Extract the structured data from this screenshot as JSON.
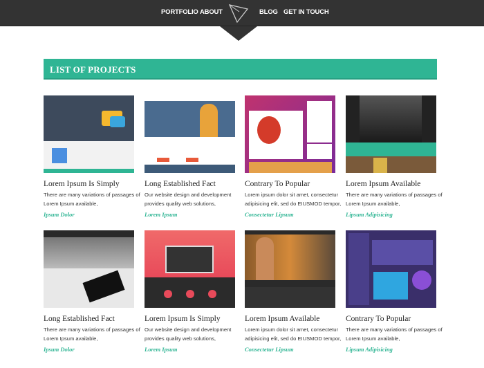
{
  "nav": {
    "items": [
      {
        "label": "PORTFOLIO"
      },
      {
        "label": "ABOUT"
      },
      {
        "label": "BLOG"
      },
      {
        "label": "GET IN TOUCH"
      }
    ]
  },
  "banner": {
    "title": "LIST OF PROJECTS"
  },
  "colors": {
    "accent": "#2fb594",
    "nav_bg": "#333333"
  },
  "projects": [
    {
      "title": "Lorem Ipsum Is Simply",
      "desc1": "There are many variations of passages of",
      "desc2": "Lorem Ipsum available,",
      "link": "Ipsum Dolor"
    },
    {
      "title": "Long Established Fact",
      "desc1": "Our website design and development",
      "desc2": "provides quality web solutions,",
      "link": "Lorem Ipsum"
    },
    {
      "title": "Contrary To Popular",
      "desc1": "Lorem ipsum dolor sit amet, consectetur",
      "desc2": "adipisicing elit, sed do EIUSMOD tempor,",
      "link": "Consectetur Lipsum"
    },
    {
      "title": "Lorem Ipsum Available",
      "desc1": "There are many variations of passages of",
      "desc2": "Lorem Ipsum available,",
      "link": "Lipsum Adipisicing"
    },
    {
      "title": "Long Established Fact",
      "desc1": "There are many variations of passages of",
      "desc2": "Lorem Ipsum available,",
      "link": "Ipsum Dolor"
    },
    {
      "title": "Lorem Ipsum Is Simply",
      "desc1": "Our website design and development",
      "desc2": "provides quality web solutions,",
      "link": "Lorem Ipsum"
    },
    {
      "title": "Lorem Ipsum Available",
      "desc1": "Lorem ipsum dolor sit amet, consectetur",
      "desc2": "adipisicing elit, sed do EIUSMOD tempor,",
      "link": "Consectetur Lipsum"
    },
    {
      "title": "Contrary To Popular",
      "desc1": "There are many variations of passages of",
      "desc2": "Lorem Ipsum available,",
      "link": "Lipsum Adipisicing"
    }
  ]
}
